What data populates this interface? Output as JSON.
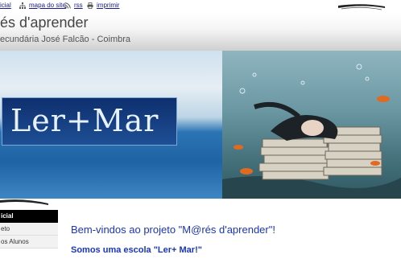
{
  "top_links": {
    "inicial": "icial",
    "mapa_do_site": "mapa do site",
    "rss": "rss",
    "imprimir": "imprimir"
  },
  "header": {
    "title": "és d'aprender",
    "subtitle": "ecundária José Falcão - Coimbra"
  },
  "banner": {
    "logo_text": "Ler+Mar"
  },
  "menu": {
    "items": [
      {
        "label": "icial",
        "active": true
      },
      {
        "label": "eto",
        "active": false
      },
      {
        "label": "os Alunos",
        "active": false
      }
    ]
  },
  "main": {
    "welcome": "Bem-vindos ao projeto \"M@rés d'aprender\"!",
    "subhead": "Somos uma escola \"Ler+ Mar!\""
  },
  "colors": {
    "link": "#1a1a8c",
    "heading_blue": "#1a35b8",
    "menu_active_bg": "#000000"
  }
}
